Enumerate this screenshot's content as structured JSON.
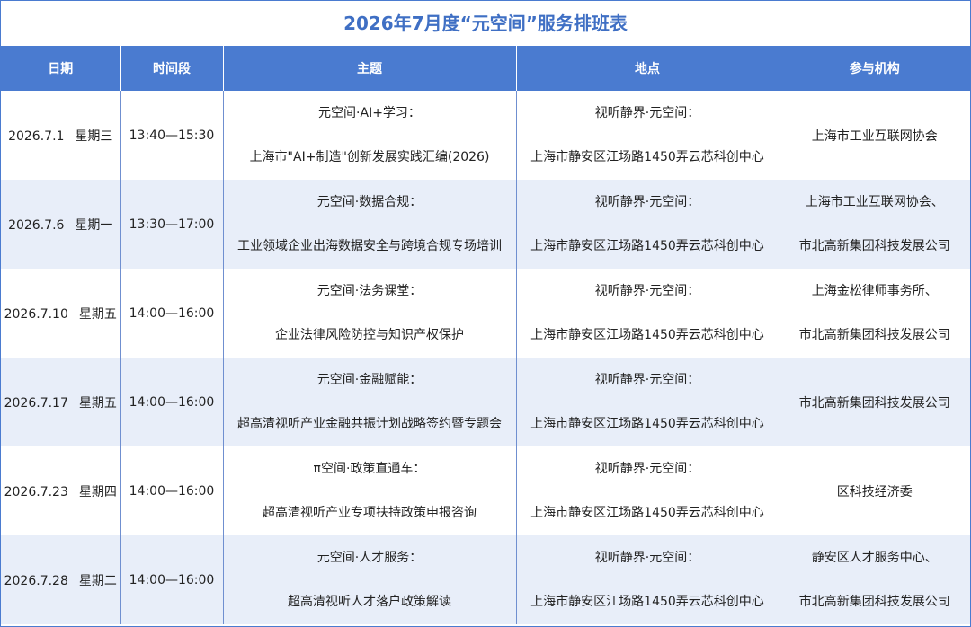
{
  "title": "2026年7月度“元空间”服务排班表",
  "header": {
    "col_date": "日期",
    "col_time": "时间段",
    "col_topic": "主题",
    "col_location": "地点",
    "col_org": "参与机构"
  },
  "rows": [
    {
      "date": "2026.7.1",
      "weekday": "星期三",
      "time": "13:40—15:30",
      "topic_line1": "元空间·AI+学习：",
      "topic_line2": "上海市\"AI+制造\"创新发展实践汇编(2026)",
      "location_line1": "视听静界·元空间：",
      "location_line2": "上海市静安区江场路1450弄云芯科创中心",
      "org_line1": "上海市工业互联网协会",
      "org_line2": ""
    },
    {
      "date": "2026.7.6",
      "weekday": "星期一",
      "time": "13:30—17:00",
      "topic_line1": "元空间·数据合规：",
      "topic_line2": "工业领域企业出海数据安全与跨境合规专场培训",
      "location_line1": "视听静界·元空间：",
      "location_line2": "上海市静安区江场路1450弄云芯科创中心",
      "org_line1": "上海市工业互联网协会、",
      "org_line2": "市北高新集团科技发展公司"
    },
    {
      "date": "2026.7.10",
      "weekday": "星期五",
      "time": "14:00—16:00",
      "topic_line1": "元空间·法务课堂：",
      "topic_line2": "企业法律风险防控与知识产权保护",
      "location_line1": "视听静界·元空间：",
      "location_line2": "上海市静安区江场路1450弄云芯科创中心",
      "org_line1": "上海金松律师事务所、",
      "org_line2": "市北高新集团科技发展公司"
    },
    {
      "date": "2026.7.17",
      "weekday": "星期五",
      "time": "14:00—16:00",
      "topic_line1": "元空间·金融赋能：",
      "topic_line2": "超高清视听产业金融共振计划战略签约暨专题会",
      "location_line1": "视听静界·元空间：",
      "location_line2": "上海市静安区江场路1450弄云芯科创中心",
      "org_line1": "市北高新集团科技发展公司",
      "org_line2": ""
    },
    {
      "date": "2026.7.23",
      "weekday": "星期四",
      "time": "14:00—16:00",
      "topic_line1": "π空间·政策直通车：",
      "topic_line2": "超高清视听产业专项扶持政策申报咨询",
      "location_line1": "视听静界·元空间：",
      "location_line2": "上海市静安区江场路1450弄云芯科创中心",
      "org_line1": "区科技经济委",
      "org_line2": ""
    },
    {
      "date": "2026.7.28",
      "weekday": "星期二",
      "time": "14:00—16:00",
      "topic_line1": "元空间·人才服务：",
      "topic_line2": "超高清视听人才落户政策解读",
      "location_line1": "视听静界·元空间：",
      "location_line2": "上海市静安区江场路1450弄云芯科创中心",
      "org_line1": "静安区人才服务中心、",
      "org_line2": "市北高新集团科技发展公司"
    }
  ]
}
